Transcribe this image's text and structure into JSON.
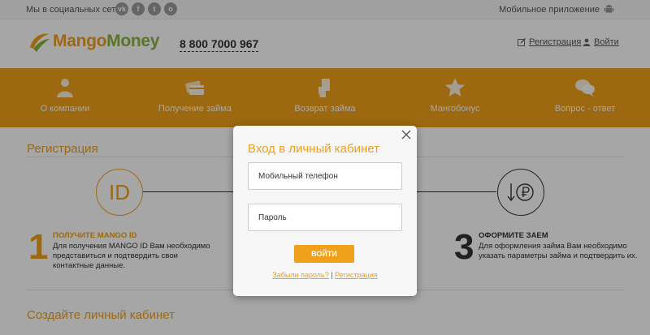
{
  "topbar": {
    "social_label": "Мы в социальных сетях:",
    "social": [
      {
        "icon": "vk-icon",
        "glyph": "vk"
      },
      {
        "icon": "facebook-icon",
        "glyph": "f"
      },
      {
        "icon": "twitter-icon",
        "glyph": "t"
      },
      {
        "icon": "odnoklassniki-icon",
        "glyph": "о"
      }
    ],
    "mobile_app_label": "Мобильное приложение"
  },
  "header": {
    "logo_part1": "Mango",
    "logo_part2": "Money",
    "phone": "8 800 7000 967",
    "register_link": "Регистрация",
    "login_link": "Войти"
  },
  "nav": {
    "items": [
      {
        "label": "О компании",
        "icon": "person-icon"
      },
      {
        "label": "Получение займа",
        "icon": "cards-icon"
      },
      {
        "label": "Возврат займа",
        "icon": "hand-card-icon"
      },
      {
        "label": "Мангобонус",
        "icon": "star-icon"
      },
      {
        "label": "Вопрос - ответ",
        "icon": "chat-icon"
      }
    ]
  },
  "content": {
    "section_title": "Регистрация",
    "id_circle_text": "ID",
    "step1": {
      "number": "1",
      "heading": "ПОЛУЧИТЕ MANGO ID",
      "text": "Для получения MANGO ID Вам необходимо представиться и подтвердить свои контактные данные."
    },
    "step3": {
      "number": "3",
      "heading": "ОФОРМИТЕ ЗАЕМ",
      "text": "Для оформления займа Вам необходимо указать параметры займа и подтвердить их."
    },
    "section_title2": "Создайте личный кабинет"
  },
  "modal": {
    "title": "Вход в личный кабинет",
    "phone_placeholder": "Мобильный телефон",
    "password_placeholder": "Пароль",
    "login_button": "ВОЙТИ",
    "forgot_link": "Забыли пароль?",
    "separator": "|",
    "register_link": "Регистрация"
  },
  "colors": {
    "accent": "#f0a01a",
    "logo_green": "#8ab43c"
  }
}
